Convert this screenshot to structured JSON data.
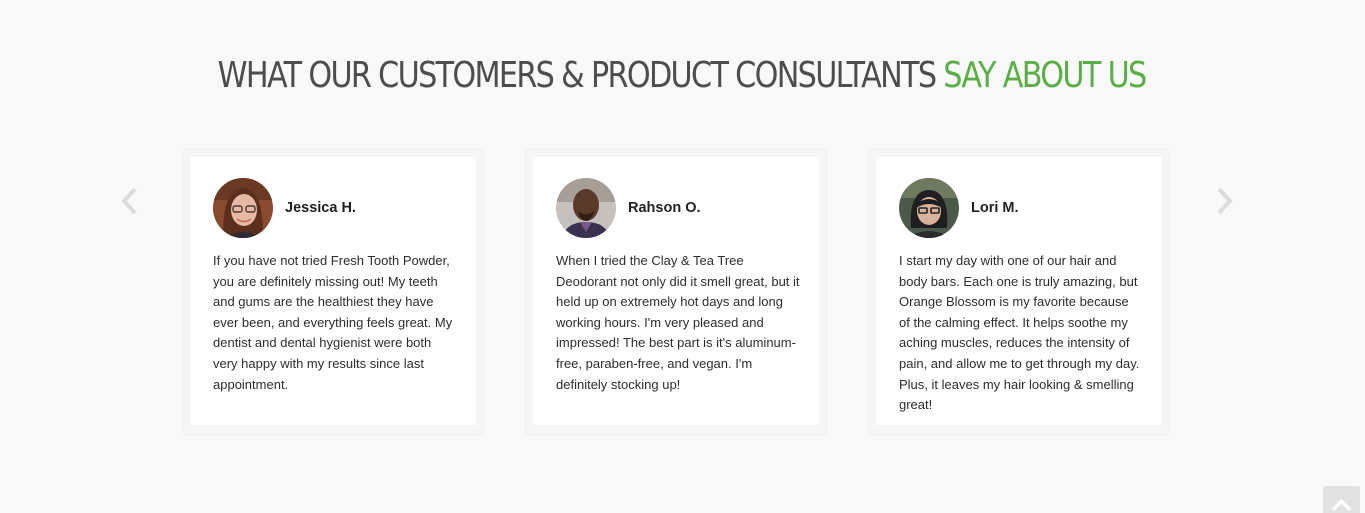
{
  "section": {
    "heading_main": "WHAT OUR CUSTOMERS & PRODUCT CONSULTANTS ",
    "heading_accent": "SAY ABOUT US",
    "accent_color": "#5aae47",
    "heading_color": "#4d4d4d"
  },
  "carousel": {
    "prev_icon": "chevron-left-icon",
    "next_icon": "chevron-right-icon"
  },
  "testimonials": [
    {
      "name": "Jessica H.",
      "quote": "If you have not tried Fresh Tooth Powder, you are definitely missing out! My teeth and gums are the healthiest they have ever been, and everything feels great. My dentist and dental hygienist were both very happy with my results since last appointment."
    },
    {
      "name": "Rahson O.",
      "quote": "When I tried the Clay & Tea Tree Deodorant not only did it smell great, but it held up on extremely hot days and long working hours. I'm very pleased and impressed! The best part is it's aluminum-free, paraben-free, and vegan. I'm definitely stocking up!"
    },
    {
      "name": "Lori M.",
      "quote": "I start my day with one of our hair and body bars. Each one is truly amazing, but Orange Blossom is my favorite because of the calming effect. It helps soothe my aching muscles, reduces the intensity of pain, and allow me to get through my day. Plus, it leaves my hair looking & smelling great!"
    }
  ],
  "scroll_top": {
    "icon": "chevron-up-icon"
  }
}
